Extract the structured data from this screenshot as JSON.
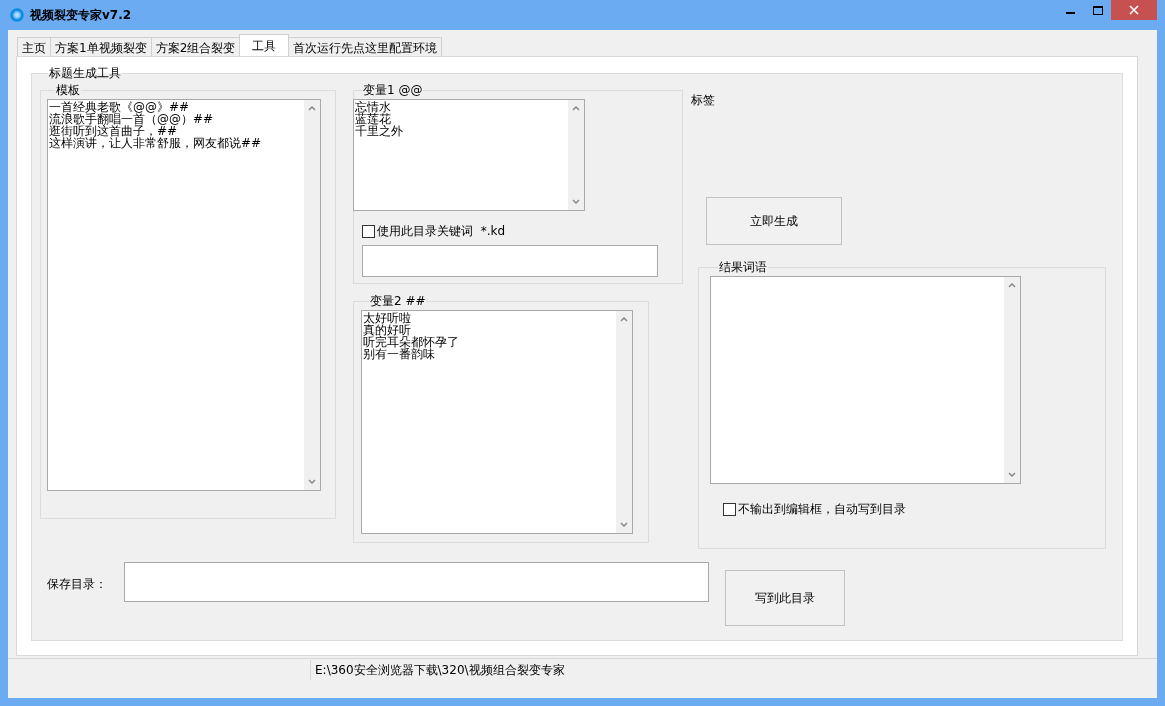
{
  "window": {
    "title": "视频裂变专家v7.2"
  },
  "tabs": [
    {
      "label": "主页",
      "selected": false
    },
    {
      "label": "方案1单视频裂变",
      "selected": false
    },
    {
      "label": "方案2组合裂变",
      "selected": false
    },
    {
      "label": "工具",
      "selected": true
    },
    {
      "label": "首次运行先点这里配置环境",
      "selected": false
    }
  ],
  "tool_group": {
    "title": "标题生成工具",
    "template": {
      "label": "模板",
      "lines": [
        "一首经典老歌《@@》##",
        "流浪歌手翻唱一首（@@）##",
        "逛街听到这首曲子，##",
        "这样演讲，让人非常舒服，网友都说##"
      ]
    },
    "variable_1": {
      "label": "变量1 @@",
      "lines": [
        "忘情水",
        "蓝莲花",
        "千里之外"
      ],
      "checkbox": {
        "label": "使用此目录关键词  *.kd",
        "checked": false
      }
    },
    "variable_2": {
      "label": "变量2  ##",
      "lines": [
        "太好听啦",
        "真的好听",
        "听完耳朵都怀孕了",
        "别有一番韵味"
      ]
    },
    "tag_label": "标签",
    "generate_button": "立即生成",
    "result": {
      "label": "结果词语",
      "checkbox": {
        "label": "不输出到编辑框，自动写到目录",
        "checked": false
      }
    },
    "save_label": "保存目录：",
    "write_button": "写到此目录"
  },
  "status_bar": "E:\\360安全浏览器下载\\320\\视频组合裂变专家"
}
